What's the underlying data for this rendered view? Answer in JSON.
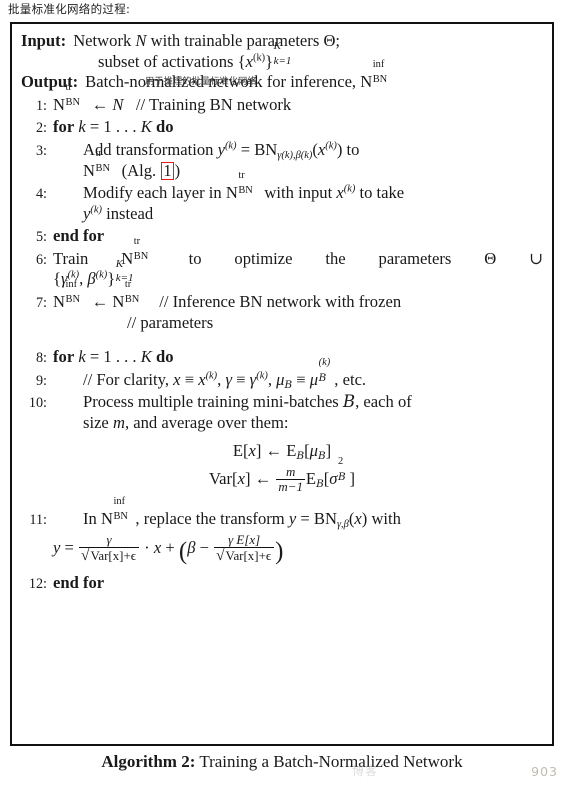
{
  "page": {
    "cn_caption": "批量标准化网络的过程:",
    "cn_note_inline": "用于推理的批量标准化网络"
  },
  "algorithm": {
    "input_key": "Input:",
    "input_line1_pre": "Network ",
    "input_line1_var": "N",
    "input_line1_post": " with trainable parameters ",
    "input_line1_theta": "Θ",
    "input_line1_end": ";",
    "input_line2_pre": "subset of activations ",
    "input_set_open": "{",
    "input_set_x": "x",
    "input_set_sup": "(k)",
    "input_set_close": "}",
    "input_set_limit_up": "K",
    "input_set_limit_dn": "k=1",
    "output_key": "Output:",
    "output_text": "Batch-normalized network for inference, ",
    "output_N": "N",
    "output_N_sup": "inf",
    "output_N_sub": "BN",
    "steps": [
      {
        "num": "1:",
        "type": "assign_comment",
        "lhs_N": "N",
        "lhs_sup": "tr",
        "lhs_sub": "BN",
        "arrow": "←",
        "rhs": "N",
        "comment": "// Training BN network"
      },
      {
        "num": "2:",
        "type": "for",
        "kw_for": "for",
        "expr_k": "k",
        "expr_eq": " = 1 . . . ",
        "expr_K": "K",
        "kw_do": "do"
      },
      {
        "num": "3:",
        "type": "text",
        "text_a": "Add  transformation ",
        "y": "y",
        "y_sup": "(k)",
        "eq": " = ",
        "bn": "BN",
        "bn_sub": "γ(k),β(k)",
        "bn_arg_open": "(",
        "bn_arg_x": "x",
        "bn_arg_sup": "(k)",
        "bn_arg_close": ")",
        "tail": " to",
        "cont_N": "N",
        "cont_sup": "tr",
        "cont_sub": "BN",
        "cont_alg": "(Alg. ",
        "cont_alg_ref": "1",
        "cont_alg_close": ")"
      },
      {
        "num": "4:",
        "type": "text",
        "text_a": "Modify each layer in ",
        "N": "N",
        "N_sup": "tr",
        "N_sub": "BN",
        "text_b": " with input ",
        "x": "x",
        "x_sup": "(k)",
        "text_c": " to take",
        "cont_y": "y",
        "cont_y_sup": "(k)",
        "cont_text": " instead"
      },
      {
        "num": "5:",
        "type": "end",
        "text": "end for"
      },
      {
        "num": "6:",
        "type": "text",
        "text_a": "Train",
        "N": "N",
        "N_sup": "tr",
        "N_sub": "BN",
        "text_b": "to",
        "text_c": "optimize",
        "text_d": "the",
        "text_e": "parameters",
        "theta": "Θ",
        "cup": "∪",
        "cont_open": "{",
        "cont_gamma": "γ",
        "cont_gamma_sup": "(k)",
        "cont_comma": ", ",
        "cont_beta": "β",
        "cont_beta_sup": "(k)",
        "cont_close": "}",
        "cont_lim_up": "K",
        "cont_lim_dn": "k=1"
      },
      {
        "num": "7:",
        "type": "assign_comment",
        "lhs_N": "N",
        "lhs_sup": "inf",
        "lhs_sub": "BN",
        "arrow": "←",
        "rhs_N": "N",
        "rhs_sup": "tr",
        "rhs_sub": "BN",
        "comment": "// Inference BN network with frozen",
        "comment2": "// parameters"
      },
      {
        "num": "8:",
        "type": "for",
        "kw_for": "for",
        "expr_k": "k",
        "expr_eq": " = 1 . . . ",
        "expr_K": "K",
        "kw_do": "do"
      },
      {
        "num": "9:",
        "type": "comment",
        "pre": "// For clarity, ",
        "x": "x",
        "equiv1": " ≡ ",
        "xk": "x",
        "xk_sup": "(k)",
        "c1": ", ",
        "gamma": "γ",
        "equiv2": " ≡ ",
        "gammak": "γ",
        "gammak_sup": "(k)",
        "c2": ", ",
        "mu": "μ",
        "mu_sub": "B",
        "equiv3": " ≡ ",
        "muk": "μ",
        "muk_sub": "B",
        "muk_sup": "(k)",
        "tail": ", etc."
      },
      {
        "num": "10:",
        "type": "text",
        "text_a": "Process multiple training mini-batches ",
        "B": "B",
        "text_b": ", each of",
        "cont_a": "size ",
        "m": "m",
        "cont_b": ", and average over them:",
        "eq1": {
          "lhs": "E[x]",
          "arrow": "←",
          "rhs": "E_B[μ_B]"
        },
        "eq2": {
          "lhs": "Var[x]",
          "arrow": "←",
          "frac_num": "m",
          "frac_den": "m−1",
          "rhs": "E_B[σ²_B]"
        }
      },
      {
        "num": "11:",
        "type": "text",
        "text_a": "In ",
        "N": "N",
        "N_sup": "inf",
        "N_sub": "BN",
        "text_b": ", replace the transform ",
        "y": "y",
        "eq": " = ",
        "bn": "BN",
        "bn_sub": "γ,β",
        "arg": "(x)",
        "text_c": " with",
        "formula": {
          "y": "y",
          "eq": "=",
          "frac1_num": "γ",
          "frac1_den_sqrt": "Var[x]+ϵ",
          "mid": "· x + ",
          "beta": "β",
          "minus": "−",
          "frac2_num": "γ E[x]",
          "frac2_den_sqrt": "Var[x]+ϵ"
        }
      },
      {
        "num": "12:",
        "type": "end",
        "text": "end for"
      }
    ]
  },
  "caption": {
    "label": "Algorithm 2:",
    "text": " Training a Batch-Normalized Network"
  },
  "watermark": {
    "number": "903",
    "text": "博客"
  }
}
